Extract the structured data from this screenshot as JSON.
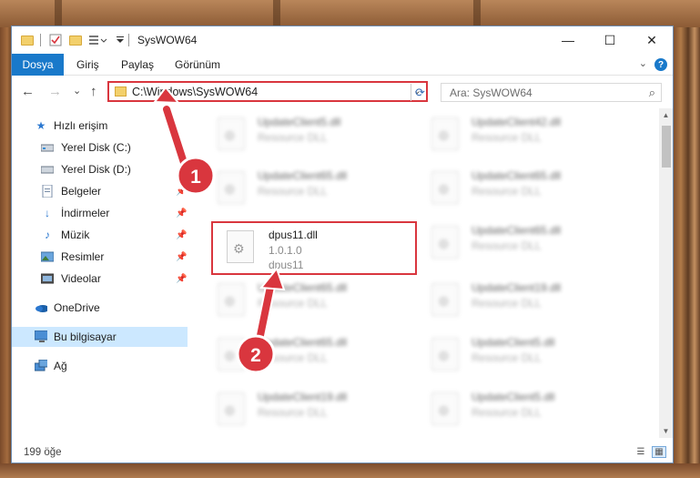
{
  "window": {
    "title": "SysWOW64",
    "minimize": "—",
    "maximize": "☐",
    "close": "✕"
  },
  "ribbon": {
    "tabs": [
      "Dosya",
      "Giriş",
      "Paylaş",
      "Görünüm"
    ],
    "help": "?"
  },
  "navigation": {
    "back": "←",
    "forward": "→",
    "recent": "⌄",
    "up": "↑",
    "address": "C:\\Windows\\SysWOW64",
    "refresh": "⟳",
    "search_placeholder": "Ara: SysWOW64"
  },
  "sidebar": {
    "items": [
      {
        "label": "Hızlı erişim",
        "icon": "star-icon"
      },
      {
        "label": "Yerel Disk (C:)",
        "icon": "drive-icon"
      },
      {
        "label": "Yerel Disk (D:)",
        "icon": "drive-icon"
      },
      {
        "label": "Belgeler",
        "icon": "documents-icon"
      },
      {
        "label": "İndirmeler",
        "icon": "download-icon"
      },
      {
        "label": "Müzik",
        "icon": "music-icon"
      },
      {
        "label": "Resimler",
        "icon": "pictures-icon"
      },
      {
        "label": "Videolar",
        "icon": "video-icon"
      },
      {
        "label": "OneDrive",
        "icon": "cloud-icon"
      },
      {
        "label": "Bu bilgisayar",
        "icon": "computer-icon"
      },
      {
        "label": "Ağ",
        "icon": "network-icon"
      }
    ]
  },
  "files": [
    {
      "name": "UpdateClient5.dll",
      "sub": "Resource DLL"
    },
    {
      "name": "UpdateClient42.dll",
      "sub": "Resource DLL"
    },
    {
      "name": "UpdateClient65.dll",
      "sub": "Resource DLL"
    },
    {
      "name": "UpdateClient65.dll",
      "sub": "Resource DLL"
    },
    {
      "name": "dpus11.dll",
      "sub": "1.0.1.0",
      "sub2": "dpus11"
    },
    {
      "name": "UpdateClient65.dll",
      "sub": "Resource DLL"
    },
    {
      "name": "UpdateClient65.dll",
      "sub": "Resource DLL"
    },
    {
      "name": "UpdateClient19.dll",
      "sub": "Resource DLL"
    },
    {
      "name": "UpdateClient65.dll",
      "sub": "Resource DLL"
    },
    {
      "name": "UpdateClient5.dll",
      "sub": "Resource DLL"
    },
    {
      "name": "UpdateClient19.dll",
      "sub": "Resource DLL"
    },
    {
      "name": "UpdateClient5.dll",
      "sub": "Resource DLL"
    }
  ],
  "status": {
    "count": "199 öğe"
  },
  "annotations": {
    "step1": "1",
    "step2": "2",
    "color": "#d9363e"
  }
}
